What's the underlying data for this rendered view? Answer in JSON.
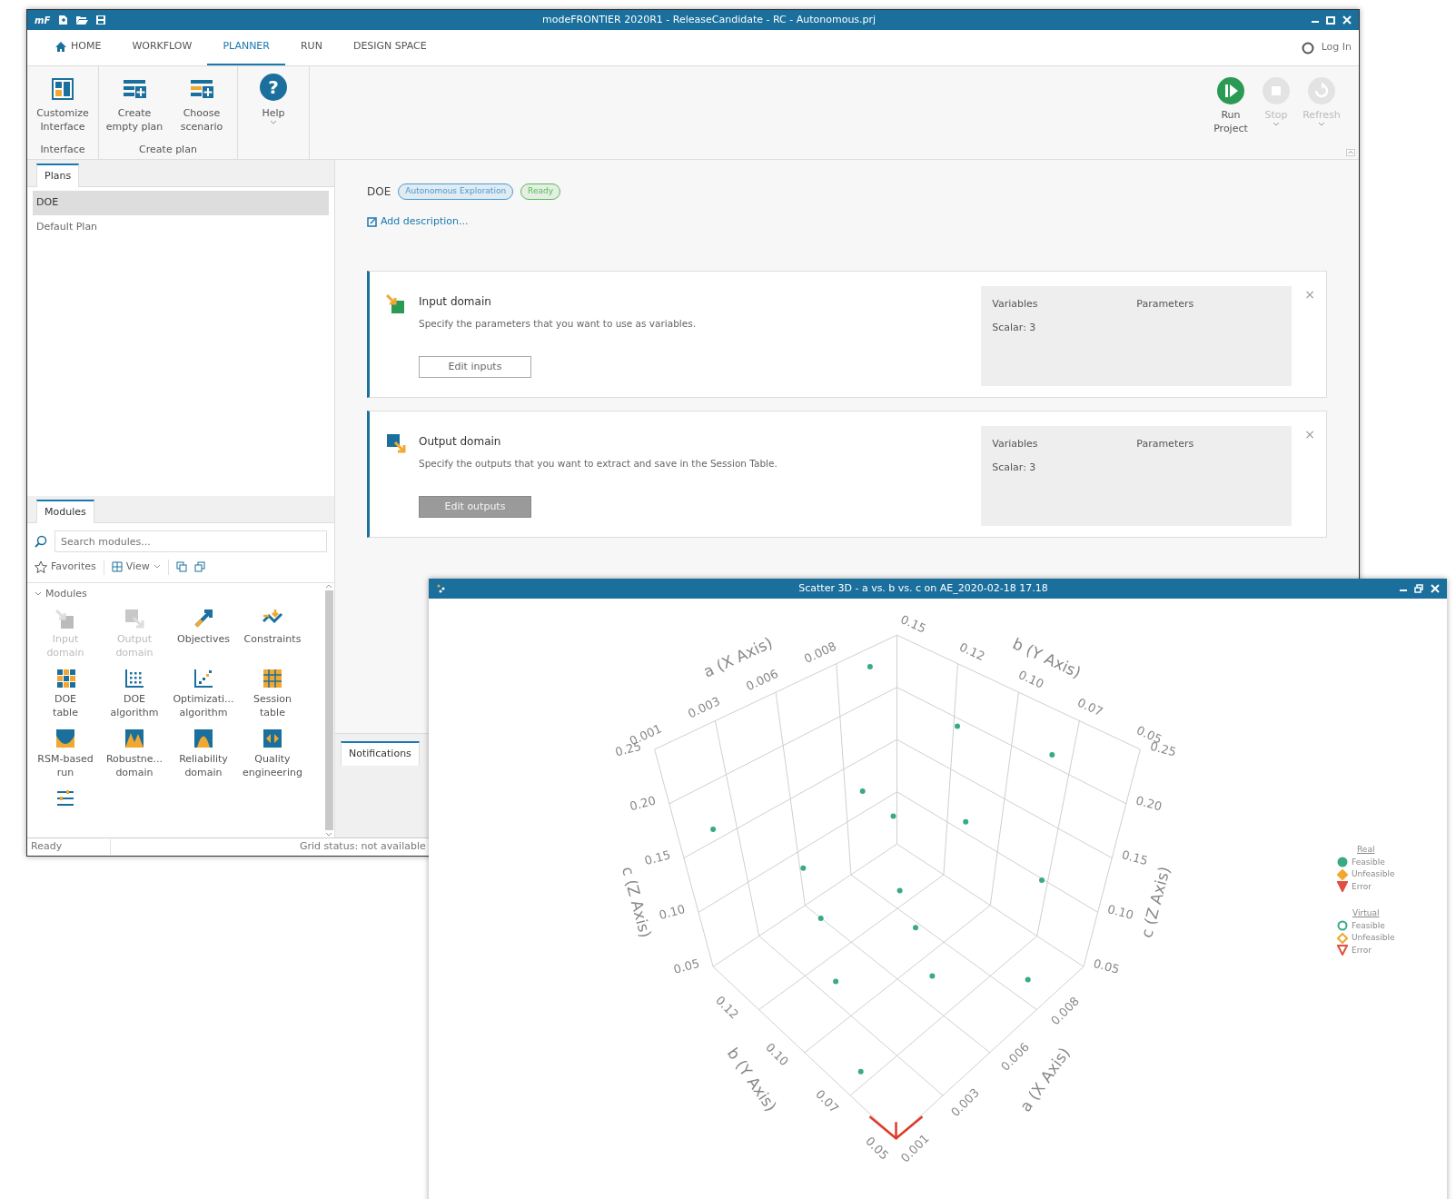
{
  "main_window": {
    "logo": "mF",
    "title": "modeFRONTIER 2020R1 - ReleaseCandidate - RC - Autonomous.prj"
  },
  "tabs": [
    {
      "label": "HOME",
      "kind": "home",
      "selected": false
    },
    {
      "label": "WORKFLOW",
      "kind": "text",
      "selected": false
    },
    {
      "label": "PLANNER",
      "kind": "text",
      "selected": true
    },
    {
      "label": "RUN",
      "kind": "text",
      "selected": false
    },
    {
      "label": "DESIGN SPACE",
      "kind": "text",
      "selected": false
    }
  ],
  "login": "Log In",
  "ribbon": {
    "groups": [
      {
        "label": "Interface",
        "items": [
          {
            "lines": [
              "Customize",
              "Interface"
            ],
            "kind": "customize",
            "dropdown": false
          }
        ]
      },
      {
        "label": "Create plan",
        "items": [
          {
            "lines": [
              "Create",
              "empty plan"
            ],
            "kind": "create",
            "dropdown": false
          },
          {
            "lines": [
              "Choose",
              "scenario"
            ],
            "kind": "choose",
            "dropdown": false
          }
        ]
      },
      {
        "items": [
          {
            "lines": [
              "Help"
            ],
            "kind": "help",
            "glyph": "?",
            "dropdown": true
          }
        ]
      }
    ],
    "actions": [
      {
        "lines": [
          "Run",
          "Project"
        ],
        "kind": "run",
        "disabled": false,
        "dropdown": false
      },
      {
        "lines": [
          "Stop"
        ],
        "kind": "stop",
        "disabled": true,
        "dropdown": true
      },
      {
        "lines": [
          "Refresh"
        ],
        "kind": "refresh",
        "disabled": true,
        "dropdown": true
      }
    ]
  },
  "plans_panel": {
    "tab": "Plans",
    "items": [
      {
        "label": "DOE",
        "selected": true
      },
      {
        "label": "Default Plan",
        "selected": false
      }
    ]
  },
  "modules_panel": {
    "tab": "Modules",
    "search_placeholder": "Search modules...",
    "favorites": "Favorites",
    "view": "View",
    "section": "Modules",
    "expanded": true,
    "items": [
      {
        "lines": [
          "Input",
          "domain"
        ],
        "kind": "input",
        "disabled": true
      },
      {
        "lines": [
          "Output",
          "domain"
        ],
        "kind": "output",
        "disabled": true
      },
      {
        "lines": [
          "Objectives"
        ],
        "kind": "objectives",
        "disabled": false
      },
      {
        "lines": [
          "Constraints"
        ],
        "kind": "constraints",
        "disabled": false
      },
      {
        "lines": [
          "DOE",
          "table"
        ],
        "kind": "doetable",
        "disabled": false
      },
      {
        "lines": [
          "DOE",
          "algorithm"
        ],
        "kind": "doealg",
        "disabled": false
      },
      {
        "lines": [
          "Optimizati...",
          "algorithm"
        ],
        "kind": "optalg",
        "disabled": false
      },
      {
        "lines": [
          "Session",
          "table"
        ],
        "kind": "session",
        "disabled": false
      },
      {
        "lines": [
          "RSM-based",
          "run"
        ],
        "kind": "rsm",
        "disabled": false
      },
      {
        "lines": [
          "Robustne...",
          "domain"
        ],
        "kind": "robust",
        "disabled": false
      },
      {
        "lines": [
          "Reliability",
          "domain"
        ],
        "kind": "reliab",
        "disabled": false
      },
      {
        "lines": [
          "Quality",
          "engineering"
        ],
        "kind": "quality",
        "disabled": false
      },
      {
        "kind": "sliders",
        "disabled": false
      }
    ]
  },
  "status_bar": {
    "left": "Ready",
    "right": "Grid status: not available"
  },
  "plan": {
    "name": "DOE",
    "badges": [
      {
        "label": "Autonomous Exploration",
        "color": "#4a9ad0"
      },
      {
        "label": "Ready",
        "color": "#5cb85c"
      }
    ],
    "add_description": "Add description...",
    "cards": [
      {
        "kind": "input",
        "title": "Input domain",
        "description": "Specify the parameters that you want to use as variables.",
        "button": {
          "label": "Edit inputs",
          "disabled": false
        },
        "columns": [
          "Variables",
          "Parameters"
        ],
        "value": "Scalar: 3",
        "close": "×"
      },
      {
        "kind": "output",
        "title": "Output domain",
        "description": "Specify the outputs that you want to extract and save in the Session Table.",
        "button": {
          "label": "Edit outputs",
          "disabled": true
        },
        "columns": [
          "Variables",
          "Parameters"
        ],
        "value": "Scalar: 3",
        "close": "×"
      }
    ]
  },
  "notifications_tab": "Notifications",
  "scatter_window": {
    "title": "Scatter 3D - a vs. b vs. c on AE_2020-02-18 17.18",
    "axes": [
      {
        "kind": "top-left",
        "label": "a (X Axis)",
        "ticks": [
          "0.001",
          "0.003",
          "0.006",
          "0.008"
        ]
      },
      {
        "kind": "top-right",
        "label": "b (Y Axis)",
        "ticks": [
          "0.15",
          "0.12",
          "0.10",
          "0.07",
          "0.05"
        ]
      },
      {
        "kind": "left-vertical",
        "label": "c (Z Axis)",
        "ticks": [
          "0.25",
          "0.20",
          "0.15",
          "0.10",
          "0.05"
        ]
      },
      {
        "kind": "right-vertical",
        "label": "c (Z Axis)",
        "ticks": [
          "0.25",
          "0.20",
          "0.15",
          "0.10",
          "0.05"
        ]
      },
      {
        "kind": "front-left",
        "label": "b (Y Axis)",
        "ticks": [
          "0.12",
          "0.10",
          "0.07",
          "0.05"
        ]
      },
      {
        "kind": "front-right",
        "label": "a (X Axis)",
        "ticks": [
          "0.001",
          "0.003",
          "0.006",
          "0.008"
        ]
      }
    ],
    "legend": [
      {
        "title": "Real",
        "filled": true,
        "items": [
          {
            "label": "Feasible",
            "kind": "circle",
            "color": "#3aaa86"
          },
          {
            "label": "Unfeasible",
            "kind": "diamond",
            "color": "#f0a830"
          },
          {
            "label": "Error",
            "kind": "triangle",
            "color": "#e05040"
          }
        ]
      },
      {
        "title": "Virtual",
        "filled": false,
        "items": [
          {
            "label": "Feasible",
            "kind": "circle",
            "color": "#3aaa86"
          },
          {
            "label": "Unfeasible",
            "kind": "diamond",
            "color": "#f0a830"
          },
          {
            "label": "Error",
            "kind": "triangle",
            "color": "#e05040"
          }
        ]
      }
    ]
  }
}
